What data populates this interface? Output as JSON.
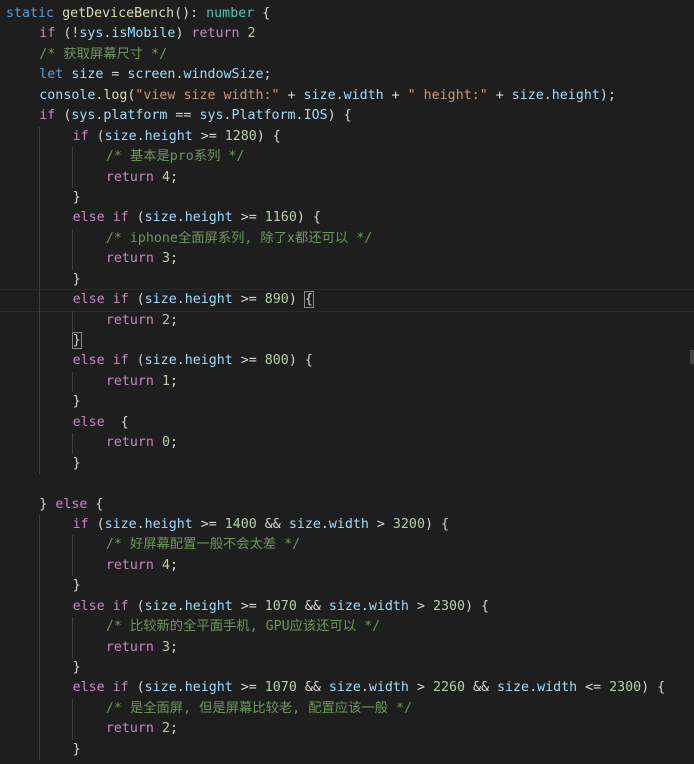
{
  "editor": {
    "lines": [
      {
        "indent": 0,
        "tokens": [
          [
            "kw",
            "static"
          ],
          [
            "punc",
            " "
          ],
          [
            "fn",
            "getDeviceBench"
          ],
          [
            "punc",
            "(): "
          ],
          [
            "type",
            "number"
          ],
          [
            "punc",
            " {"
          ]
        ]
      },
      {
        "indent": 1,
        "tokens": [
          [
            "ctl",
            "if"
          ],
          [
            "punc",
            " (!"
          ],
          [
            "var",
            "sys"
          ],
          [
            "punc",
            "."
          ],
          [
            "var",
            "isMobile"
          ],
          [
            "punc",
            ") "
          ],
          [
            "ctl",
            "return"
          ],
          [
            "punc",
            " "
          ],
          [
            "num",
            "2"
          ]
        ]
      },
      {
        "indent": 1,
        "tokens": [
          [
            "cmt",
            "/* 获取屏幕尺寸 */"
          ]
        ]
      },
      {
        "indent": 1,
        "tokens": [
          [
            "kw",
            "let"
          ],
          [
            "punc",
            " "
          ],
          [
            "var",
            "size"
          ],
          [
            "punc",
            " = "
          ],
          [
            "var",
            "screen"
          ],
          [
            "punc",
            "."
          ],
          [
            "var",
            "windowSize"
          ],
          [
            "punc",
            ";"
          ]
        ]
      },
      {
        "indent": 1,
        "tokens": [
          [
            "var",
            "console"
          ],
          [
            "punc",
            "."
          ],
          [
            "fn",
            "log"
          ],
          [
            "punc",
            "("
          ],
          [
            "str",
            "\"view size width:\""
          ],
          [
            "punc",
            " + "
          ],
          [
            "var",
            "size"
          ],
          [
            "punc",
            "."
          ],
          [
            "var",
            "width"
          ],
          [
            "punc",
            " + "
          ],
          [
            "str",
            "\" height:\""
          ],
          [
            "punc",
            " + "
          ],
          [
            "var",
            "size"
          ],
          [
            "punc",
            "."
          ],
          [
            "var",
            "height"
          ],
          [
            "punc",
            ");"
          ]
        ]
      },
      {
        "indent": 1,
        "tokens": [
          [
            "ctl",
            "if"
          ],
          [
            "punc",
            " ("
          ],
          [
            "var",
            "sys"
          ],
          [
            "punc",
            "."
          ],
          [
            "var",
            "platform"
          ],
          [
            "punc",
            " == "
          ],
          [
            "var",
            "sys"
          ],
          [
            "punc",
            "."
          ],
          [
            "var",
            "Platform"
          ],
          [
            "punc",
            "."
          ],
          [
            "var",
            "IOS"
          ],
          [
            "punc",
            ") {"
          ]
        ]
      },
      {
        "indent": 2,
        "tokens": [
          [
            "ctl",
            "if"
          ],
          [
            "punc",
            " ("
          ],
          [
            "var",
            "size"
          ],
          [
            "punc",
            "."
          ],
          [
            "var",
            "height"
          ],
          [
            "punc",
            " >= "
          ],
          [
            "num",
            "1280"
          ],
          [
            "punc",
            ") {"
          ]
        ]
      },
      {
        "indent": 3,
        "tokens": [
          [
            "cmt",
            "/* 基本是pro系列 */"
          ]
        ]
      },
      {
        "indent": 3,
        "tokens": [
          [
            "ctl",
            "return"
          ],
          [
            "punc",
            " "
          ],
          [
            "num",
            "4"
          ],
          [
            "punc",
            ";"
          ]
        ]
      },
      {
        "indent": 2,
        "tokens": [
          [
            "punc",
            "}"
          ]
        ]
      },
      {
        "indent": 2,
        "tokens": [
          [
            "ctl",
            "else"
          ],
          [
            "punc",
            " "
          ],
          [
            "ctl",
            "if"
          ],
          [
            "punc",
            " ("
          ],
          [
            "var",
            "size"
          ],
          [
            "punc",
            "."
          ],
          [
            "var",
            "height"
          ],
          [
            "punc",
            " >= "
          ],
          [
            "num",
            "1160"
          ],
          [
            "punc",
            ") {"
          ]
        ]
      },
      {
        "indent": 3,
        "tokens": [
          [
            "cmt",
            "/* iphone全面屏系列, 除了x都还可以 */"
          ]
        ]
      },
      {
        "indent": 3,
        "tokens": [
          [
            "ctl",
            "return"
          ],
          [
            "punc",
            " "
          ],
          [
            "num",
            "3"
          ],
          [
            "punc",
            ";"
          ]
        ]
      },
      {
        "indent": 2,
        "tokens": [
          [
            "punc",
            "}"
          ]
        ]
      },
      {
        "indent": 2,
        "current": true,
        "tokens": [
          [
            "ctl",
            "else"
          ],
          [
            "punc",
            " "
          ],
          [
            "ctl",
            "if"
          ],
          [
            "punc",
            " ("
          ],
          [
            "var",
            "size"
          ],
          [
            "punc",
            "."
          ],
          [
            "var",
            "height"
          ],
          [
            "punc",
            " >= "
          ],
          [
            "num",
            "890"
          ],
          [
            "punc",
            ") "
          ],
          [
            "bm",
            "{"
          ]
        ]
      },
      {
        "indent": 3,
        "tokens": [
          [
            "ctl",
            "return"
          ],
          [
            "punc",
            " "
          ],
          [
            "num",
            "2"
          ],
          [
            "punc",
            ";"
          ]
        ]
      },
      {
        "indent": 2,
        "tokens": [
          [
            "bm",
            "}"
          ]
        ]
      },
      {
        "indent": 2,
        "tokens": [
          [
            "ctl",
            "else"
          ],
          [
            "punc",
            " "
          ],
          [
            "ctl",
            "if"
          ],
          [
            "punc",
            " ("
          ],
          [
            "var",
            "size"
          ],
          [
            "punc",
            "."
          ],
          [
            "var",
            "height"
          ],
          [
            "punc",
            " >= "
          ],
          [
            "num",
            "800"
          ],
          [
            "punc",
            ") {"
          ]
        ]
      },
      {
        "indent": 3,
        "tokens": [
          [
            "ctl",
            "return"
          ],
          [
            "punc",
            " "
          ],
          [
            "num",
            "1"
          ],
          [
            "punc",
            ";"
          ]
        ]
      },
      {
        "indent": 2,
        "tokens": [
          [
            "punc",
            "}"
          ]
        ]
      },
      {
        "indent": 2,
        "tokens": [
          [
            "ctl",
            "else"
          ],
          [
            "punc",
            "  {"
          ]
        ]
      },
      {
        "indent": 3,
        "tokens": [
          [
            "ctl",
            "return"
          ],
          [
            "punc",
            " "
          ],
          [
            "num",
            "0"
          ],
          [
            "punc",
            ";"
          ]
        ]
      },
      {
        "indent": 2,
        "tokens": [
          [
            "punc",
            "}"
          ]
        ]
      },
      {
        "indent": 0,
        "tokens": []
      },
      {
        "indent": 1,
        "tokens": [
          [
            "punc",
            "} "
          ],
          [
            "ctl",
            "else"
          ],
          [
            "punc",
            " {"
          ]
        ]
      },
      {
        "indent": 2,
        "tokens": [
          [
            "ctl",
            "if"
          ],
          [
            "punc",
            " ("
          ],
          [
            "var",
            "size"
          ],
          [
            "punc",
            "."
          ],
          [
            "var",
            "height"
          ],
          [
            "punc",
            " >= "
          ],
          [
            "num",
            "1400"
          ],
          [
            "punc",
            " && "
          ],
          [
            "var",
            "size"
          ],
          [
            "punc",
            "."
          ],
          [
            "var",
            "width"
          ],
          [
            "punc",
            " > "
          ],
          [
            "num",
            "3200"
          ],
          [
            "punc",
            ") {"
          ]
        ]
      },
      {
        "indent": 3,
        "tokens": [
          [
            "cmt",
            "/* 好屏幕配置一般不会太差 */"
          ]
        ]
      },
      {
        "indent": 3,
        "tokens": [
          [
            "ctl",
            "return"
          ],
          [
            "punc",
            " "
          ],
          [
            "num",
            "4"
          ],
          [
            "punc",
            ";"
          ]
        ]
      },
      {
        "indent": 2,
        "tokens": [
          [
            "punc",
            "}"
          ]
        ]
      },
      {
        "indent": 2,
        "tokens": [
          [
            "ctl",
            "else"
          ],
          [
            "punc",
            " "
          ],
          [
            "ctl",
            "if"
          ],
          [
            "punc",
            " ("
          ],
          [
            "var",
            "size"
          ],
          [
            "punc",
            "."
          ],
          [
            "var",
            "height"
          ],
          [
            "punc",
            " >= "
          ],
          [
            "num",
            "1070"
          ],
          [
            "punc",
            " && "
          ],
          [
            "var",
            "size"
          ],
          [
            "punc",
            "."
          ],
          [
            "var",
            "width"
          ],
          [
            "punc",
            " > "
          ],
          [
            "num",
            "2300"
          ],
          [
            "punc",
            ") {"
          ]
        ]
      },
      {
        "indent": 3,
        "tokens": [
          [
            "cmt",
            "/* 比较新的全平面手机, GPU应该还可以 */"
          ]
        ]
      },
      {
        "indent": 3,
        "tokens": [
          [
            "ctl",
            "return"
          ],
          [
            "punc",
            " "
          ],
          [
            "num",
            "3"
          ],
          [
            "punc",
            ";"
          ]
        ]
      },
      {
        "indent": 2,
        "tokens": [
          [
            "punc",
            "}"
          ]
        ]
      },
      {
        "indent": 2,
        "tokens": [
          [
            "ctl",
            "else"
          ],
          [
            "punc",
            " "
          ],
          [
            "ctl",
            "if"
          ],
          [
            "punc",
            " ("
          ],
          [
            "var",
            "size"
          ],
          [
            "punc",
            "."
          ],
          [
            "var",
            "height"
          ],
          [
            "punc",
            " >= "
          ],
          [
            "num",
            "1070"
          ],
          [
            "punc",
            " && "
          ],
          [
            "var",
            "size"
          ],
          [
            "punc",
            "."
          ],
          [
            "var",
            "width"
          ],
          [
            "punc",
            " > "
          ],
          [
            "num",
            "2260"
          ],
          [
            "punc",
            " && "
          ],
          [
            "var",
            "size"
          ],
          [
            "punc",
            "."
          ],
          [
            "var",
            "width"
          ],
          [
            "punc",
            " <= "
          ],
          [
            "num",
            "2300"
          ],
          [
            "punc",
            ") {"
          ]
        ]
      },
      {
        "indent": 3,
        "tokens": [
          [
            "cmt",
            "/* 是全面屏, 但是屏幕比较老, 配置应该一般 */"
          ]
        ]
      },
      {
        "indent": 3,
        "tokens": [
          [
            "ctl",
            "return"
          ],
          [
            "punc",
            " "
          ],
          [
            "num",
            "2"
          ],
          [
            "punc",
            ";"
          ]
        ]
      },
      {
        "indent": 2,
        "tokens": [
          [
            "punc",
            "}"
          ]
        ]
      }
    ]
  }
}
